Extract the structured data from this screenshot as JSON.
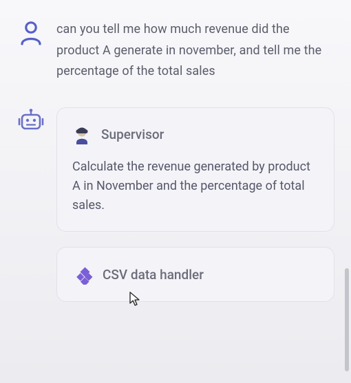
{
  "user": {
    "message": "can you tell me how much revenue did the product A generate in november, and tell me the percentage of the total sales"
  },
  "assistant": {
    "cards": [
      {
        "title": "Supervisor",
        "body": "Calculate the revenue generated by product A in November and the percentage of total sales."
      },
      {
        "title": "CSV data handler",
        "body": ""
      }
    ]
  }
}
